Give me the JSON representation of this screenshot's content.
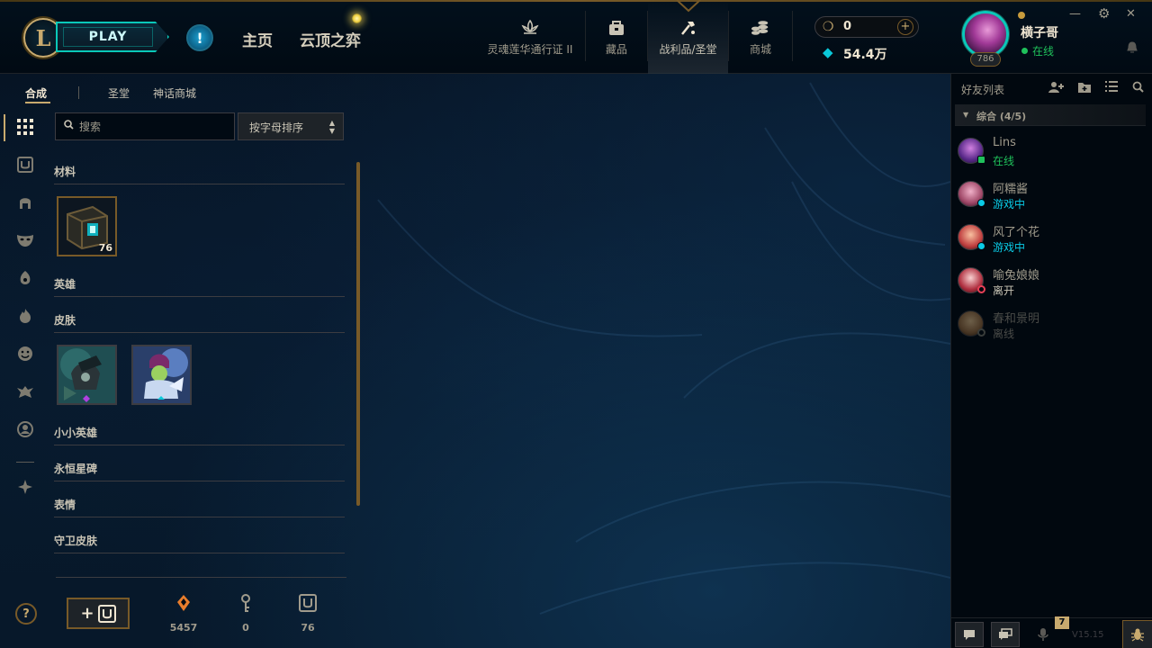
{
  "header": {
    "play_label": "PLAY",
    "alert_symbol": "!",
    "nav": {
      "home": "主页",
      "tft": "云顶之弈",
      "pass": "灵魂莲华通行证 II",
      "collection": "藏品",
      "loot": "战利品/圣堂",
      "store": "商城"
    },
    "currency": {
      "rp_value": "0",
      "be_value": "54.4万",
      "add_symbol": "+"
    },
    "profile": {
      "level": "786",
      "name": "横子哥",
      "status": "在线"
    },
    "window": {
      "minimize": "—",
      "settings": "⚙",
      "close": "✕"
    }
  },
  "loot": {
    "tabs": [
      "合成",
      "圣堂",
      "神话商城"
    ],
    "search_placeholder": "搜索",
    "sort_label": "按字母排序",
    "categories": [
      {
        "title": "材料"
      },
      {
        "title": "英雄"
      },
      {
        "title": "皮肤"
      },
      {
        "title": "小小英雄"
      },
      {
        "title": "永恒星碑"
      },
      {
        "title": "表情"
      },
      {
        "title": "守卫皮肤"
      }
    ],
    "material_count": "76",
    "footer": {
      "orange_essence": "5457",
      "keys": "0",
      "chests": "76",
      "help": "?",
      "add_chest": "+"
    }
  },
  "social": {
    "title": "好友列表",
    "group": "综合 (4/5)",
    "friends": [
      {
        "name": "Lins",
        "status": "在线",
        "status_color": "#1fc15b"
      },
      {
        "name": "阿糯酱",
        "status": "游戏中",
        "status_color": "#0acbe6"
      },
      {
        "name": "风了个花",
        "status": "游戏中",
        "status_color": "#0acbe6"
      },
      {
        "name": "喻兔娘娘",
        "status": "离开",
        "status_color": "#c8c3b4"
      },
      {
        "name": "春和景明",
        "status": "离线",
        "status_color": "#a09b8c"
      }
    ],
    "notifications_count": "7",
    "version": "V15.15"
  },
  "colors": {
    "gold": "#c8aa6e",
    "teal": "#0ac8b9",
    "online": "#1fc15b",
    "ingame": "#0acbe6",
    "away": "#e84057"
  }
}
